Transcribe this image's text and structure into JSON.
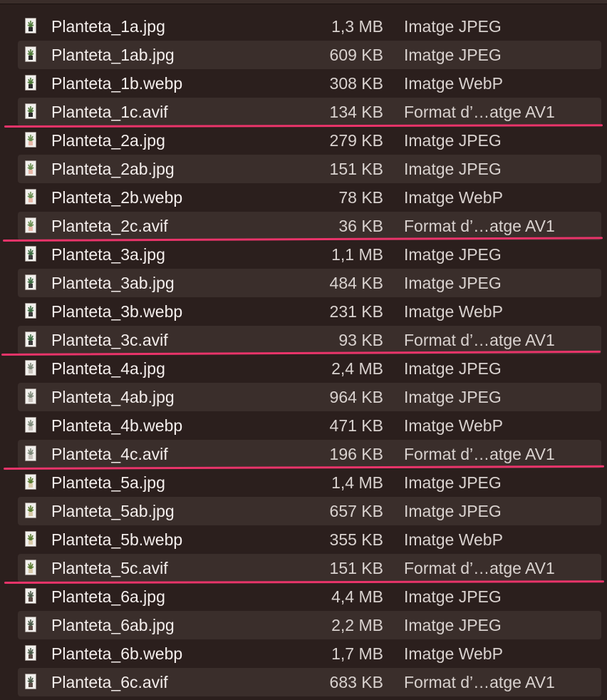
{
  "colors": {
    "background": "#2b1f1d",
    "alt_row": "#3a2e2b",
    "text": "#f4eeec",
    "secondary_text": "#d9d2cf",
    "annotation_line": "#e9346a"
  },
  "files": [
    {
      "name": "Planteta_1a.jpg",
      "size": "1,3 MB",
      "kind": "Imatge JPEG",
      "thumb": "plant-1"
    },
    {
      "name": "Planteta_1ab.jpg",
      "size": "609 KB",
      "kind": "Imatge JPEG",
      "thumb": "plant-1"
    },
    {
      "name": "Planteta_1b.webp",
      "size": "308 KB",
      "kind": "Imatge WebP",
      "thumb": "plant-1"
    },
    {
      "name": "Planteta_1c.avif",
      "size": "134 KB",
      "kind": "Format d’…atge AV1",
      "thumb": "plant-1",
      "underlined": true
    },
    {
      "name": "Planteta_2a.jpg",
      "size": "279 KB",
      "kind": "Imatge JPEG",
      "thumb": "plant-2"
    },
    {
      "name": "Planteta_2ab.jpg",
      "size": "151 KB",
      "kind": "Imatge JPEG",
      "thumb": "plant-2"
    },
    {
      "name": "Planteta_2b.webp",
      "size": "78 KB",
      "kind": "Imatge WebP",
      "thumb": "plant-2"
    },
    {
      "name": "Planteta_2c.avif",
      "size": "36 KB",
      "kind": "Format d’…atge AV1",
      "thumb": "plant-2",
      "underlined": true
    },
    {
      "name": "Planteta_3a.jpg",
      "size": "1,1 MB",
      "kind": "Imatge JPEG",
      "thumb": "plant-3"
    },
    {
      "name": "Planteta_3ab.jpg",
      "size": "484 KB",
      "kind": "Imatge JPEG",
      "thumb": "plant-3"
    },
    {
      "name": "Planteta_3b.webp",
      "size": "231 KB",
      "kind": "Imatge WebP",
      "thumb": "plant-3"
    },
    {
      "name": "Planteta_3c.avif",
      "size": "93 KB",
      "kind": "Format d’…atge AV1",
      "thumb": "plant-3",
      "underlined": true
    },
    {
      "name": "Planteta_4a.jpg",
      "size": "2,4 MB",
      "kind": "Imatge JPEG",
      "thumb": "plant-4"
    },
    {
      "name": "Planteta_4ab.jpg",
      "size": "964 KB",
      "kind": "Imatge JPEG",
      "thumb": "plant-4"
    },
    {
      "name": "Planteta_4b.webp",
      "size": "471 KB",
      "kind": "Imatge WebP",
      "thumb": "plant-4"
    },
    {
      "name": "Planteta_4c.avif",
      "size": "196 KB",
      "kind": "Format d’…atge AV1",
      "thumb": "plant-4",
      "underlined": true
    },
    {
      "name": "Planteta_5a.jpg",
      "size": "1,4 MB",
      "kind": "Imatge JPEG",
      "thumb": "plant-5"
    },
    {
      "name": "Planteta_5ab.jpg",
      "size": "657 KB",
      "kind": "Imatge JPEG",
      "thumb": "plant-5"
    },
    {
      "name": "Planteta_5b.webp",
      "size": "355 KB",
      "kind": "Imatge WebP",
      "thumb": "plant-5"
    },
    {
      "name": "Planteta_5c.avif",
      "size": "151 KB",
      "kind": "Format d’…atge AV1",
      "thumb": "plant-5",
      "underlined": true
    },
    {
      "name": "Planteta_6a.jpg",
      "size": "4,4 MB",
      "kind": "Imatge JPEG",
      "thumb": "plant-6"
    },
    {
      "name": "Planteta_6ab.jpg",
      "size": "2,2 MB",
      "kind": "Imatge JPEG",
      "thumb": "plant-6"
    },
    {
      "name": "Planteta_6b.webp",
      "size": "1,7 MB",
      "kind": "Imatge WebP",
      "thumb": "plant-6"
    },
    {
      "name": "Planteta_6c.avif",
      "size": "683 KB",
      "kind": "Format d’…atge AV1",
      "thumb": "plant-6"
    }
  ]
}
